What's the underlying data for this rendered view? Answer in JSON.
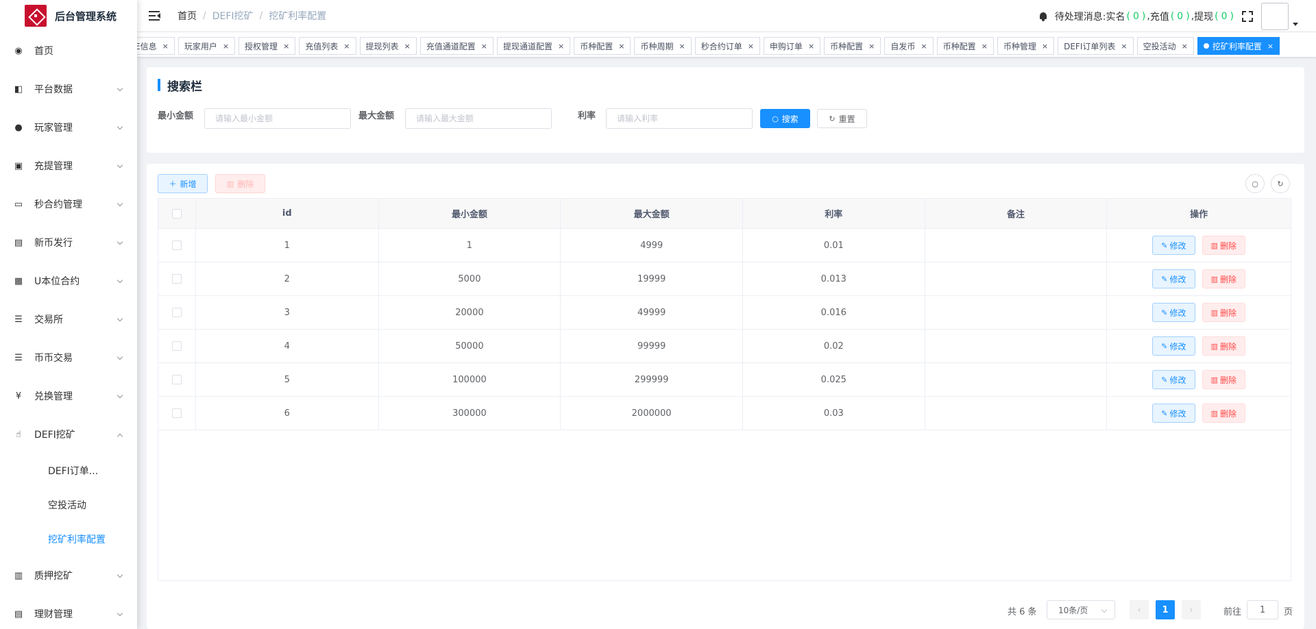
{
  "app": {
    "title": "后台管理系统"
  },
  "sidebar": {
    "items": [
      {
        "label": "首页",
        "icon": "dashboard-icon",
        "glyph": "◉",
        "has_children": false
      },
      {
        "label": "平台数据",
        "icon": "book-icon",
        "glyph": "◧",
        "has_children": true
      },
      {
        "label": "玩家管理",
        "icon": "user-icon",
        "glyph": "●",
        "has_children": true
      },
      {
        "label": "充提管理",
        "icon": "clipboard-icon",
        "glyph": "▣",
        "has_children": true
      },
      {
        "label": "秒合约管理",
        "icon": "monitor-icon",
        "glyph": "▭",
        "has_children": true
      },
      {
        "label": "新币发行",
        "icon": "form-icon",
        "glyph": "▤",
        "has_children": true
      },
      {
        "label": "U本位合约",
        "icon": "grid-icon",
        "glyph": "▦",
        "has_children": true
      },
      {
        "label": "交易所",
        "icon": "list-tree-icon",
        "glyph": "☰",
        "has_children": true
      },
      {
        "label": "币币交易",
        "icon": "list-icon",
        "glyph": "☰",
        "has_children": true
      },
      {
        "label": "兑换管理",
        "icon": "yen-icon",
        "glyph": "¥",
        "has_children": true
      },
      {
        "label": "DEFI挖矿",
        "icon": "hand-icon",
        "glyph": "☝",
        "has_children": true,
        "expanded": true
      },
      {
        "label": "质押挖矿",
        "icon": "bar-chart-icon",
        "glyph": "▥",
        "has_children": true
      },
      {
        "label": "理财管理",
        "icon": "document-icon",
        "glyph": "▤",
        "has_children": true
      }
    ],
    "defi_children": [
      {
        "label": "DEFI订单..."
      },
      {
        "label": "空投活动"
      },
      {
        "label": "挖矿利率配置",
        "active": true
      }
    ]
  },
  "header": {
    "breadcrumb": [
      "首页",
      "DEFI挖矿",
      "挖矿利率配置"
    ],
    "pending_label": "待处理消息:",
    "real_name_label": "实名",
    "real_name_count": "0",
    "recharge_label": "充值",
    "recharge_count": "0",
    "withdraw_label": "提现",
    "withdraw_count": "0"
  },
  "tags": [
    {
      "label": "E信息"
    },
    {
      "label": "玩家用户"
    },
    {
      "label": "授权管理"
    },
    {
      "label": "充值列表"
    },
    {
      "label": "提现列表"
    },
    {
      "label": "充值通道配置"
    },
    {
      "label": "提现通道配置"
    },
    {
      "label": "币种配置"
    },
    {
      "label": "币种周期"
    },
    {
      "label": "秒合约订单"
    },
    {
      "label": "申购订单"
    },
    {
      "label": "币种配置"
    },
    {
      "label": "自发币"
    },
    {
      "label": "币种配置"
    },
    {
      "label": "币种管理"
    },
    {
      "label": "DEFI订单列表"
    },
    {
      "label": "空投活动"
    },
    {
      "label": "挖矿利率配置",
      "active": true
    }
  ],
  "search": {
    "title": "搜索栏",
    "min_label": "最小金额",
    "min_placeholder": "请输入最小金额",
    "max_label": "最大金额",
    "max_placeholder": "请输入最大金额",
    "rate_label": "利率",
    "rate_placeholder": "请输入利率",
    "search_button": "搜索",
    "reset_button": "重置"
  },
  "toolbar": {
    "add_label": "新增",
    "delete_label": "删除"
  },
  "table": {
    "columns": [
      "id",
      "最小金额",
      "最大金额",
      "利率",
      "备注",
      "操作"
    ],
    "rows": [
      {
        "id": "1",
        "min": "1",
        "max": "4999",
        "rate": "0.01",
        "note": ""
      },
      {
        "id": "2",
        "min": "5000",
        "max": "19999",
        "rate": "0.013",
        "note": ""
      },
      {
        "id": "3",
        "min": "20000",
        "max": "49999",
        "rate": "0.016",
        "note": ""
      },
      {
        "id": "4",
        "min": "50000",
        "max": "99999",
        "rate": "0.02",
        "note": ""
      },
      {
        "id": "5",
        "min": "100000",
        "max": "299999",
        "rate": "0.025",
        "note": ""
      },
      {
        "id": "6",
        "min": "300000",
        "max": "2000000",
        "rate": "0.03",
        "note": ""
      }
    ],
    "edit_label": "修改",
    "delete_label": "删除"
  },
  "pagination": {
    "total": "共 6 条",
    "page_size": "10条/页",
    "current_page": "1",
    "goto_label": "前往",
    "goto_value": "1",
    "page_suffix": "页"
  },
  "colors": {
    "primary": "#1890ff",
    "danger": "#ff4949",
    "success": "#13ce66",
    "brand": "#c8102e"
  }
}
